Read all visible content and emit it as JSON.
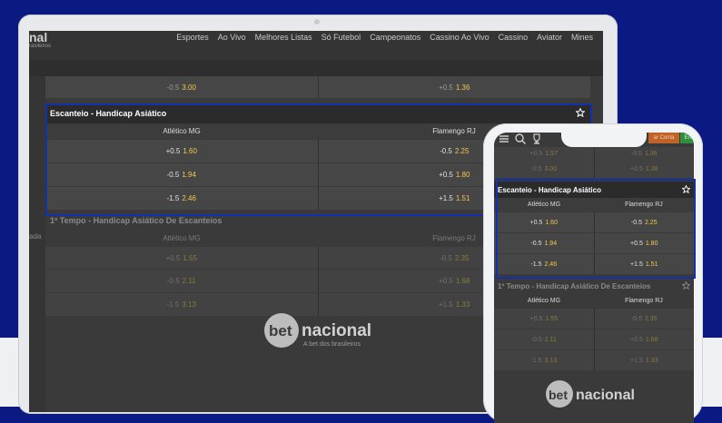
{
  "nav": {
    "logo_text": "nal",
    "logo_sub": "rasileiros",
    "items": [
      "Esportes",
      "Ao Vivo",
      "Melhores Listas",
      "Só Futebol",
      "Campeonatos",
      "Cassino Ao Vivo",
      "Cassino",
      "Aviator",
      "Mines"
    ]
  },
  "side_label": "ada",
  "top_row": {
    "left_line": "-0.5",
    "left_odd": "3.00",
    "right_line": "+0.5",
    "right_odd": "1.36"
  },
  "market1": {
    "title": "Escanteio - Handicap Asiático",
    "team_home": "Atlético MG",
    "team_away": "Flamengo RJ",
    "rows": [
      {
        "home_line": "+0.5",
        "home_odd": "1.60",
        "away_line": "-0.5",
        "away_odd": "2.25"
      },
      {
        "home_line": "-0.5",
        "home_odd": "1.94",
        "away_line": "+0.5",
        "away_odd": "1.80"
      },
      {
        "home_line": "-1.5",
        "home_odd": "2.46",
        "away_line": "+1.5",
        "away_odd": "1.51"
      }
    ]
  },
  "market2": {
    "title": "1º Tempo - Handicap Asiático De Escanteios",
    "team_home": "Atlético MG",
    "team_away": "Flamengo RJ",
    "rows": [
      {
        "home_line": "+0.5",
        "home_odd": "1.55",
        "away_line": "-0.5",
        "away_odd": "2.35"
      },
      {
        "home_line": "-0.5",
        "home_odd": "2.11",
        "away_line": "+0.5",
        "away_odd": "1.68"
      },
      {
        "home_line": "-1.5",
        "home_odd": "3.13",
        "away_line": "+1.5",
        "away_odd": "1.33"
      }
    ]
  },
  "brand": {
    "name_left": "bet",
    "name_right": "nacional",
    "tagline": "A bet dos brasileiros"
  },
  "phone": {
    "btn_orange": "ar Conta",
    "btn_green": "Entr",
    "top_row": {
      "left_line": "-0.5",
      "left_odd": "3.00",
      "right_line": "+0.5",
      "right_odd": "1.36"
    },
    "partial_row": {
      "left_line": "+0.5",
      "left_odd": "1.57",
      "right_line": "-0.5",
      "right_odd": "1.36"
    }
  },
  "colors": {
    "accent_odd": "#f2c94c",
    "highlight_border": "#1530a8",
    "background_blue": "#0a1a82"
  }
}
